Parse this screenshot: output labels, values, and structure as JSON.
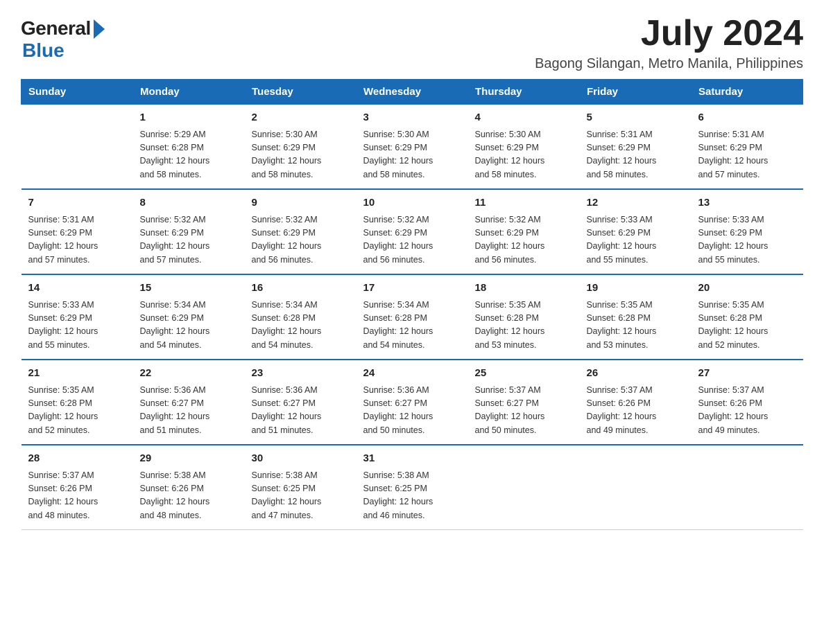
{
  "logo": {
    "general": "General",
    "blue": "Blue"
  },
  "title": {
    "month_year": "July 2024",
    "location": "Bagong Silangan, Metro Manila, Philippines"
  },
  "header": {
    "days": [
      "Sunday",
      "Monday",
      "Tuesday",
      "Wednesday",
      "Thursday",
      "Friday",
      "Saturday"
    ]
  },
  "weeks": [
    [
      {
        "day": "",
        "info": ""
      },
      {
        "day": "1",
        "info": "Sunrise: 5:29 AM\nSunset: 6:28 PM\nDaylight: 12 hours\nand 58 minutes."
      },
      {
        "day": "2",
        "info": "Sunrise: 5:30 AM\nSunset: 6:29 PM\nDaylight: 12 hours\nand 58 minutes."
      },
      {
        "day": "3",
        "info": "Sunrise: 5:30 AM\nSunset: 6:29 PM\nDaylight: 12 hours\nand 58 minutes."
      },
      {
        "day": "4",
        "info": "Sunrise: 5:30 AM\nSunset: 6:29 PM\nDaylight: 12 hours\nand 58 minutes."
      },
      {
        "day": "5",
        "info": "Sunrise: 5:31 AM\nSunset: 6:29 PM\nDaylight: 12 hours\nand 58 minutes."
      },
      {
        "day": "6",
        "info": "Sunrise: 5:31 AM\nSunset: 6:29 PM\nDaylight: 12 hours\nand 57 minutes."
      }
    ],
    [
      {
        "day": "7",
        "info": "Sunrise: 5:31 AM\nSunset: 6:29 PM\nDaylight: 12 hours\nand 57 minutes."
      },
      {
        "day": "8",
        "info": "Sunrise: 5:32 AM\nSunset: 6:29 PM\nDaylight: 12 hours\nand 57 minutes."
      },
      {
        "day": "9",
        "info": "Sunrise: 5:32 AM\nSunset: 6:29 PM\nDaylight: 12 hours\nand 56 minutes."
      },
      {
        "day": "10",
        "info": "Sunrise: 5:32 AM\nSunset: 6:29 PM\nDaylight: 12 hours\nand 56 minutes."
      },
      {
        "day": "11",
        "info": "Sunrise: 5:32 AM\nSunset: 6:29 PM\nDaylight: 12 hours\nand 56 minutes."
      },
      {
        "day": "12",
        "info": "Sunrise: 5:33 AM\nSunset: 6:29 PM\nDaylight: 12 hours\nand 55 minutes."
      },
      {
        "day": "13",
        "info": "Sunrise: 5:33 AM\nSunset: 6:29 PM\nDaylight: 12 hours\nand 55 minutes."
      }
    ],
    [
      {
        "day": "14",
        "info": "Sunrise: 5:33 AM\nSunset: 6:29 PM\nDaylight: 12 hours\nand 55 minutes."
      },
      {
        "day": "15",
        "info": "Sunrise: 5:34 AM\nSunset: 6:29 PM\nDaylight: 12 hours\nand 54 minutes."
      },
      {
        "day": "16",
        "info": "Sunrise: 5:34 AM\nSunset: 6:28 PM\nDaylight: 12 hours\nand 54 minutes."
      },
      {
        "day": "17",
        "info": "Sunrise: 5:34 AM\nSunset: 6:28 PM\nDaylight: 12 hours\nand 54 minutes."
      },
      {
        "day": "18",
        "info": "Sunrise: 5:35 AM\nSunset: 6:28 PM\nDaylight: 12 hours\nand 53 minutes."
      },
      {
        "day": "19",
        "info": "Sunrise: 5:35 AM\nSunset: 6:28 PM\nDaylight: 12 hours\nand 53 minutes."
      },
      {
        "day": "20",
        "info": "Sunrise: 5:35 AM\nSunset: 6:28 PM\nDaylight: 12 hours\nand 52 minutes."
      }
    ],
    [
      {
        "day": "21",
        "info": "Sunrise: 5:35 AM\nSunset: 6:28 PM\nDaylight: 12 hours\nand 52 minutes."
      },
      {
        "day": "22",
        "info": "Sunrise: 5:36 AM\nSunset: 6:27 PM\nDaylight: 12 hours\nand 51 minutes."
      },
      {
        "day": "23",
        "info": "Sunrise: 5:36 AM\nSunset: 6:27 PM\nDaylight: 12 hours\nand 51 minutes."
      },
      {
        "day": "24",
        "info": "Sunrise: 5:36 AM\nSunset: 6:27 PM\nDaylight: 12 hours\nand 50 minutes."
      },
      {
        "day": "25",
        "info": "Sunrise: 5:37 AM\nSunset: 6:27 PM\nDaylight: 12 hours\nand 50 minutes."
      },
      {
        "day": "26",
        "info": "Sunrise: 5:37 AM\nSunset: 6:26 PM\nDaylight: 12 hours\nand 49 minutes."
      },
      {
        "day": "27",
        "info": "Sunrise: 5:37 AM\nSunset: 6:26 PM\nDaylight: 12 hours\nand 49 minutes."
      }
    ],
    [
      {
        "day": "28",
        "info": "Sunrise: 5:37 AM\nSunset: 6:26 PM\nDaylight: 12 hours\nand 48 minutes."
      },
      {
        "day": "29",
        "info": "Sunrise: 5:38 AM\nSunset: 6:26 PM\nDaylight: 12 hours\nand 48 minutes."
      },
      {
        "day": "30",
        "info": "Sunrise: 5:38 AM\nSunset: 6:25 PM\nDaylight: 12 hours\nand 47 minutes."
      },
      {
        "day": "31",
        "info": "Sunrise: 5:38 AM\nSunset: 6:25 PM\nDaylight: 12 hours\nand 46 minutes."
      },
      {
        "day": "",
        "info": ""
      },
      {
        "day": "",
        "info": ""
      },
      {
        "day": "",
        "info": ""
      }
    ]
  ]
}
